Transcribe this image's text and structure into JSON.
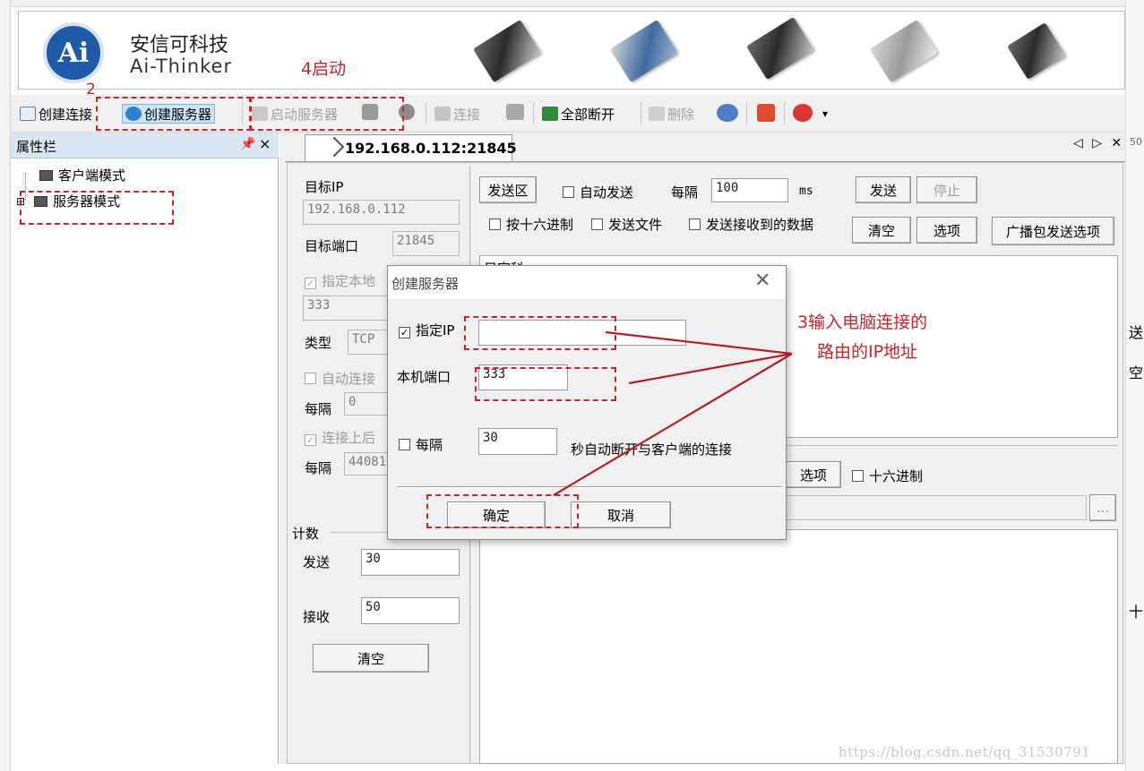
{
  "brand": {
    "logo_text": "Ai",
    "name_cn": "安信可科技",
    "name_en": "Ai-Thinker"
  },
  "toolbar": {
    "connect": "创建连接",
    "create_server": "创建服务器",
    "start_server": "启动服务器",
    "link": "连接",
    "disconnect_all": "全部断开",
    "delete": "删除"
  },
  "sidebar": {
    "title": "属性栏",
    "pin": "ᵖ",
    "close": "×",
    "items": [
      {
        "label": "客户端模式",
        "expander": ""
      },
      {
        "label": "服务器模式",
        "expander": "⊞"
      }
    ]
  },
  "tab": {
    "label": "192.168.0.112:21845",
    "nav": "◁ ▷ ✕"
  },
  "left_panel": {
    "target_ip_label": "目标IP",
    "target_ip_value": "192.168.0.112",
    "target_port_label": "目标端口",
    "target_port_value": "21845",
    "local_check_label": "指定本地",
    "local_value": "333",
    "type_label": "类型",
    "type_value": "TCP",
    "auto_connect_label": "自动连接",
    "every_label": "每隔",
    "every_value": "0",
    "on_connect_label": "连接上后",
    "every2_label": "每隔",
    "every2_value": "44081",
    "count_label": "计数",
    "send_label": "发送",
    "send_value": "30",
    "recv_label": "接收",
    "recv_value": "50",
    "clear_btn": "清空"
  },
  "send_area": {
    "send_zone_btn": "发送区",
    "auto_send_label": "自动发送",
    "interval_label": "每隔",
    "interval_value": "100",
    "ms_label": "ms",
    "send_btn": "发送",
    "stop_btn": "停止",
    "hex_label": "按十六进制",
    "send_file_label": "发送文件",
    "send_received_label": "发送接收到的数据",
    "clear_btn": "清空",
    "options_btn": "选项",
    "broadcast_btn": "广播包发送选项",
    "text_value": "只字科"
  },
  "recv_area": {
    "options_btn": "选项",
    "hex_label": "十六进制",
    "browse_btn": "..."
  },
  "dialog": {
    "title": "创建服务器",
    "close": "╳",
    "specify_ip_label": "指定IP",
    "specify_ip_value": "",
    "local_port_label": "本机端口",
    "local_port_value": "333",
    "every_label": "每隔",
    "every_value": "30",
    "auto_disconnect_label": "秒自动断开与客户端的连接",
    "ok_btn": "确定",
    "cancel_btn": "取消"
  },
  "annotations": {
    "step2": "2",
    "step4": "4启动",
    "step3_line1": "3输入电脑连接的",
    "step3_line2": "路由的IP地址",
    "color": "#c8262c"
  },
  "edge_fragments": {
    "right_top": "50",
    "right_a": "送",
    "right_b": "空",
    "right_c": "十"
  },
  "watermark": "https://blog.csdn.net/qq_31530791"
}
